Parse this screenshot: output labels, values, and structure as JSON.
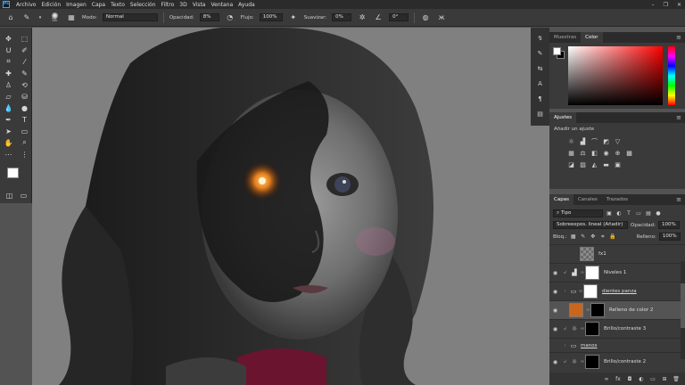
{
  "menu": {
    "app_logo": "Ps",
    "items": [
      "Archivo",
      "Edición",
      "Imagen",
      "Capa",
      "Texto",
      "Selección",
      "Filtro",
      "3D",
      "Vista",
      "Ventana",
      "Ayuda"
    ],
    "window_controls": [
      "–",
      "❐",
      "✕"
    ]
  },
  "options_bar": {
    "brush_size": "56",
    "mode_label": "Modo:",
    "mode_value": "Normal",
    "opacity_label": "Opacidad:",
    "opacity_value": "8%",
    "flow_label": "Flujo:",
    "flow_value": "100%",
    "smooth_label": "Suavizar:",
    "smooth_value": "0%",
    "angle_value": "0°"
  },
  "panels": {
    "color_tabs": [
      "Muestras",
      "Color"
    ],
    "color_active": "Color",
    "adjustments_title": "Ajustes",
    "adjustments_add": "Añadir un ajuste",
    "layers_tabs": [
      "Capas",
      "Canales",
      "Trazados"
    ],
    "layers_active": "Capas",
    "filter_kind": "Tipo",
    "blend_mode": "Sobreexpos. lineal (Añadir)",
    "opacity_label": "Opacidad:",
    "opacity_value": "100%",
    "lock_label": "Bloq.:",
    "fill_label": "Relleno:",
    "fill_value": "100%"
  },
  "layers": [
    {
      "name": "fx1",
      "type": "group-thumb",
      "visible": false
    },
    {
      "name": "Niveles 1",
      "type": "adjustment",
      "visible": true
    },
    {
      "name": "dientes panza",
      "type": "folder",
      "visible": true
    },
    {
      "name": "Relleno de color 2",
      "type": "fill",
      "visible": true,
      "selected": true,
      "fill_color": "#c9661e"
    },
    {
      "name": "Brillo/contraste 3",
      "type": "adjustment",
      "visible": true
    },
    {
      "name": "manos",
      "type": "folder",
      "visible": false
    },
    {
      "name": "Brillo/contraste 2",
      "type": "adjustment",
      "visible": true
    }
  ],
  "colors": {
    "accent_blue": "#31a8ff",
    "fill_orange": "#c9661e"
  }
}
